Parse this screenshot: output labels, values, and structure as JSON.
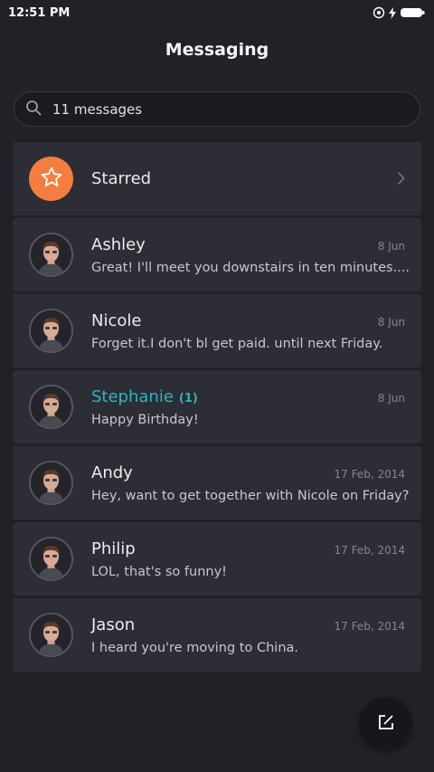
{
  "status_bar": {
    "time": "12:51 PM",
    "icons": [
      "sync-icon",
      "charging-icon",
      "battery-icon"
    ]
  },
  "header": {
    "title": "Messaging"
  },
  "search": {
    "placeholder": "11 messages",
    "icon": "search-icon"
  },
  "starred": {
    "label": "Starred",
    "icon": "star-icon",
    "accent": "#f57d3f"
  },
  "conversations": [
    {
      "name": "Ashley",
      "date": "8 Jun",
      "preview": "Great! I'll meet you downstairs in ten minutes....",
      "unread": ""
    },
    {
      "name": "Nicole",
      "date": "8 Jun",
      "preview": "Forget it.I don't bl get paid. until next Friday.",
      "unread": ""
    },
    {
      "name": "Stephanie",
      "date": "8 Jun",
      "preview": "Happy Birthday!",
      "unread": "(1)"
    },
    {
      "name": "Andy",
      "date": "17 Feb, 2014",
      "preview": "Hey, want to get together with Nicole on Friday?",
      "unread": ""
    },
    {
      "name": "Philip",
      "date": "17 Feb, 2014",
      "preview": "LOL, that's so funny!",
      "unread": ""
    },
    {
      "name": "Jason",
      "date": "17 Feb, 2014",
      "preview": "I heard you're moving to China.",
      "unread": ""
    }
  ],
  "colors": {
    "background": "#212228",
    "card": "#2c2d35",
    "unread_accent": "#2ab7c2"
  },
  "fab": {
    "icon": "compose-icon"
  }
}
